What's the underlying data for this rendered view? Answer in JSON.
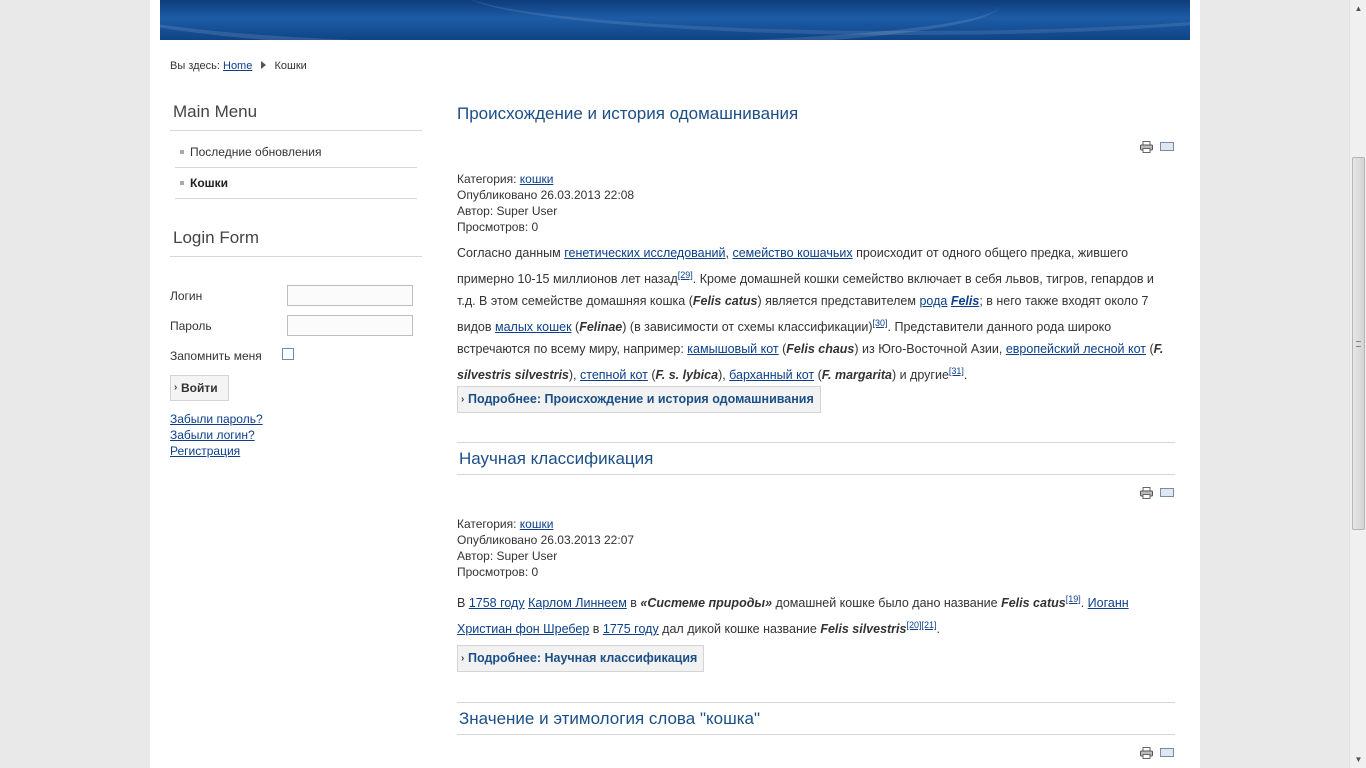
{
  "breadcrumb": {
    "prefix": "Вы здесь:",
    "home": "Home",
    "current": "Кошки"
  },
  "sidebar": {
    "main_menu": {
      "title": "Main Menu",
      "items": [
        {
          "label": "Последние обновления",
          "active": false
        },
        {
          "label": "Кошки",
          "active": true
        }
      ]
    },
    "login": {
      "title": "Login Form",
      "username_label": "Логин",
      "password_label": "Пароль",
      "remember_label": "Запомнить меня",
      "remember_checked": false,
      "submit": "Войти",
      "links": [
        "Забыли пароль?",
        "Забыли логин?",
        "Регистрация"
      ]
    }
  },
  "articles": [
    {
      "title": "Происхождение и история одомашнивания",
      "category_label": "Категория:",
      "category": "кошки",
      "published": "Опубликовано 26.03.2013 22:08",
      "author": "Автор: Super User",
      "views": "Просмотров: 0",
      "body": {
        "t1": "Согласно данным ",
        "l1": "генетических исследований",
        "t2": ", ",
        "l2": "семейство кошачьих",
        "t3": " происходит от одного общего предка, жившего примерно 10-15 миллионов лет назад",
        "ref1": "[29]",
        "t4": ". Кроме домашней кошки семейство включает в себя львов, тигров, гепардов и т.д. В этом семействе домашняя кошка (",
        "b1": "Felis catus",
        "t5": ") является представителем ",
        "l3": "рода",
        "t6": " ",
        "l4": "Felis",
        "t7": "; в него также входят около 7 видов ",
        "l5": "малых кошек",
        "t8": " (",
        "b2": "Felinae",
        "t9": ") (в зависимости от схемы классификации)",
        "ref2": "[30]",
        "t10": ". Представители данного рода широко встречаются по всему миру, например: ",
        "l6": "камышовый кот",
        "t11": " (",
        "b3": "Felis chaus",
        "t12": ") из Юго-Восточной Азии, ",
        "l7": "европейский лесной кот",
        "t13": " (",
        "b4": "F. silvestris silvestris",
        "t14": "), ",
        "l8": "степной кот",
        "t15": " (",
        "b5": "F. s. lybica",
        "t16": "), ",
        "l9": "барханный кот",
        "t17": " (",
        "b6": "F. margarita",
        "t18": ") и другие",
        "ref3": "[31]",
        "t19": "."
      },
      "more": "Подробнее: Происхождение и история одомашнивания"
    },
    {
      "title": "Научная классификация",
      "category_label": "Категория:",
      "category": "кошки",
      "published": "Опубликовано 26.03.2013 22:07",
      "author": "Автор: Super User",
      "views": "Просмотров: 0",
      "body": {
        "t1": "В ",
        "l1": "1758 году",
        "t2": " ",
        "l2": "Карлом Линнеем",
        "t3": " в ",
        "b1": "«Системе природы»",
        "t4": " домашней кошке было дано название ",
        "b2": "Felis catus",
        "ref1": "[19]",
        "t5": ". ",
        "l3": "Иоганн Христиан фон Шребер",
        "t6": " в ",
        "l4": "1775 году",
        "t7": " дал дикой кошке название ",
        "b3": "Felis silvestris",
        "ref2": "[20]",
        "ref3": "[21]",
        "t8": "."
      },
      "more": "Подробнее: Научная классификация"
    },
    {
      "title": "Значение и этимология слова \"кошка\""
    }
  ],
  "icons": {
    "print": "printer-icon",
    "email": "email-icon"
  },
  "colors": {
    "banner": "#1d5ca7",
    "title": "#1b4f86",
    "link": "#0b3f8a"
  }
}
